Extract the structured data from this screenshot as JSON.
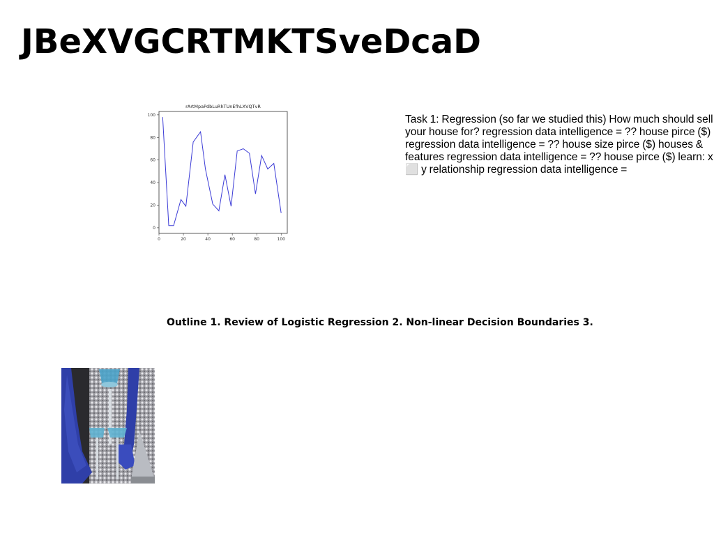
{
  "slide": {
    "title": "JBeXVGCRTMKTSveDcaD",
    "task_text": "Task 1: Regression (so far we studied this) How much should sell your house for? regression data intelligence = ?? house pirce ($) regression data intelligence = ?? house size pirce ($) houses & features regression data intelligence = ?? house pirce ($) learn: x ⬜ y relationship regression data intelligence =",
    "outline_text": "Outline 1. Review of Logistic Regression 2. Non-linear Decision Boundaries 3."
  },
  "colors": {
    "line": "#3b3bd6",
    "photo_bg": "#1a1a1a",
    "glove": "#2f3fa8",
    "sequin": "#c0c0c4"
  },
  "chart_data": {
    "type": "line",
    "title": "rArtMpaPdbLuRhTUnEfhLXVQTvR",
    "x": [
      3,
      8,
      13,
      18,
      23,
      28,
      33,
      38,
      43,
      48,
      53,
      58,
      63,
      68,
      73,
      78,
      83,
      88,
      93,
      98,
      100
    ],
    "series": [
      {
        "values": [
          98,
          2,
          2,
          25,
          19,
          76,
          85,
          52,
          21,
          15,
          47,
          19,
          68,
          70,
          66,
          30,
          64,
          52,
          57,
          37,
          13
        ]
      }
    ],
    "x_points": [
      3,
      8,
      12,
      18,
      22,
      28,
      34,
      38,
      44,
      49,
      54,
      59,
      64,
      69,
      74,
      79,
      84,
      89,
      94,
      100
    ],
    "y_points": [
      98,
      2,
      2,
      25,
      19,
      76,
      85,
      52,
      21,
      15,
      47,
      19,
      68,
      70,
      66,
      30,
      64,
      52,
      57,
      13
    ],
    "xticks": [
      "0",
      "20",
      "40",
      "60",
      "80",
      "100"
    ],
    "yticks": [
      "0",
      "20",
      "40",
      "60",
      "80",
      "100"
    ],
    "xlim": [
      0,
      105
    ],
    "ylim": [
      -5,
      103
    ],
    "grid": false
  }
}
